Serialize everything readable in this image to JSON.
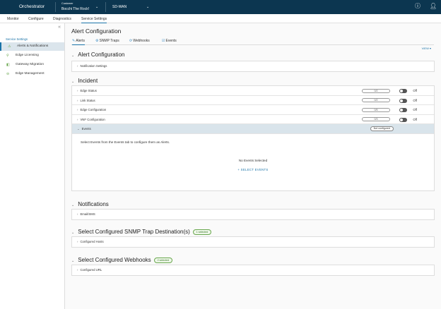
{
  "topbar": {
    "brand": "Orchestrator",
    "customer_label": "Customer",
    "customer_value": "Bocchi The Rock!",
    "network": "SD-WAN"
  },
  "nav": [
    "Monitor",
    "Configure",
    "Diagnostics",
    "Service Settings"
  ],
  "sidebar": {
    "header": "Service Settings",
    "items": [
      "Alerts & Notifications",
      "Edge Licensing",
      "Gateway Migration",
      "Edge Management"
    ]
  },
  "page": {
    "title": "Alert Configuration",
    "tabs": [
      "Alerts",
      "SNMP Traps",
      "Webhooks",
      "Events"
    ],
    "view": "VIEW ▾"
  },
  "alert_config": {
    "title": "Alert Configuration",
    "row": "Notification Settings"
  },
  "incident": {
    "title": "Incident",
    "rows": [
      {
        "label": "Edge Status",
        "count": "0/2",
        "state": "Off"
      },
      {
        "label": "Link Status",
        "count": "0/2",
        "state": "Off"
      },
      {
        "label": "Edge Configuration",
        "count": "0/5",
        "state": "Off"
      },
      {
        "label": "VNF Configuration",
        "count": "0/3",
        "state": "Off"
      }
    ],
    "events": {
      "label": "Events",
      "badge": "Not configured",
      "message": "Select Events from the Events tab to configure them as Alerts.",
      "empty": "No Events Selected",
      "button": "+ SELECT EVENTS"
    }
  },
  "notifications": {
    "title": "Notifications",
    "row": "Email/SMS"
  },
  "snmp": {
    "title": "Select Configured SNMP Trap Destination(s)",
    "badge": "1 selected",
    "row": "Configured Hosts"
  },
  "webhooks": {
    "title": "Select Configured Webhooks",
    "badge": "2 selected",
    "row": "Configured URL"
  }
}
